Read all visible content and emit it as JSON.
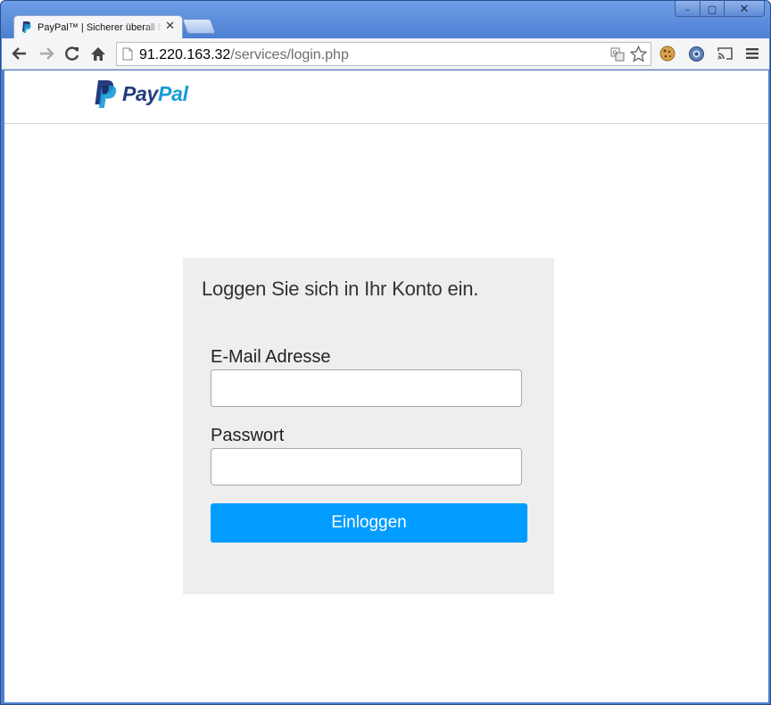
{
  "window": {
    "controls": {
      "minimize": "–",
      "maximize": "▢",
      "close": "✕"
    }
  },
  "tab": {
    "title": "PayPal™ | Sicherer überall bezahlen",
    "close": "✕",
    "favicon": "paypal-favicon-icon"
  },
  "toolbar": {
    "back": "back-arrow-icon",
    "forward": "forward-arrow-icon",
    "reload": "reload-icon",
    "home": "home-icon",
    "url_host": "91.220.163.32",
    "url_path": "/services/login.php",
    "translate": "translate-icon",
    "bookmark": "star-icon",
    "extensions": [
      "cookie-icon",
      "globe-extension-icon",
      "cast-icon",
      "menu-icon"
    ]
  },
  "header": {
    "logo_pay": "Pay",
    "logo_pal": "Pal"
  },
  "login": {
    "heading": "Loggen Sie sich in Ihr Konto ein.",
    "email_label": "E-Mail Adresse",
    "email_value": "",
    "password_label": "Passwort",
    "password_value": "",
    "button_label": "Einloggen"
  },
  "colors": {
    "brand_dark": "#253b80",
    "brand_light": "#179bd7",
    "button": "#009cff",
    "card_bg": "#eeeeee"
  }
}
